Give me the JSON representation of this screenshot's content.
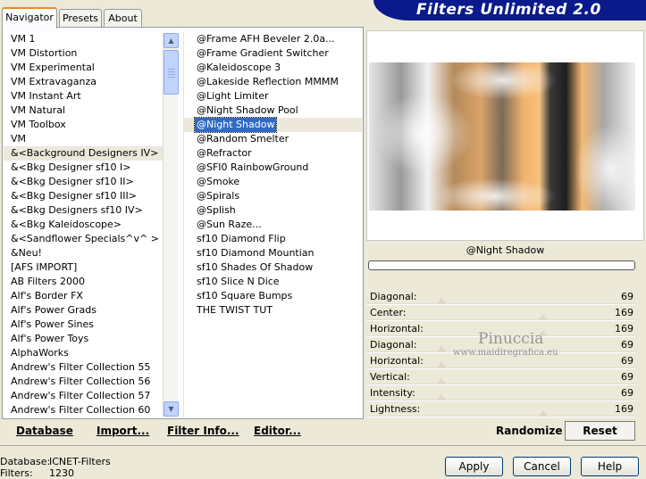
{
  "app_title": "Filters Unlimited 2.0",
  "tabs": [
    {
      "label": "Navigator",
      "active": true
    },
    {
      "label": "Presets",
      "active": false
    },
    {
      "label": "About",
      "active": false
    }
  ],
  "categories": [
    "VM 1",
    "VM Distortion",
    "VM Experimental",
    "VM Extravaganza",
    "VM Instant Art",
    "VM Natural",
    "VM Toolbox",
    "VM",
    "&<Background Designers IV>",
    "&<Bkg Designer sf10 I>",
    "&<Bkg Designer sf10 II>",
    "&<Bkg Designer sf10 III>",
    "&<Bkg Designers sf10 IV>",
    "&<Bkg Kaleidoscope>",
    "&<Sandflower Specials^v^ >",
    "&Neu!",
    "[AFS IMPORT]",
    "AB Filters 2000",
    "Alf's Border FX",
    "Alf's Power Grads",
    "Alf's Power Sines",
    "Alf's Power Toys",
    "AlphaWorks",
    "Andrew's Filter Collection 55",
    "Andrew's Filter Collection 56",
    "Andrew's Filter Collection 57",
    "Andrew's Filter Collection 60"
  ],
  "selected_category": "&<Background Designers IV>",
  "filters": [
    "@Frame AFH Beveler 2.0a...",
    "@Frame Gradient Switcher",
    "@Kaleidoscope 3",
    "@Lakeside Reflection MMMM",
    "@Light Limiter",
    "@Night Shadow Pool",
    "@Night Shadow",
    "@Random Smelter",
    "@Refractor",
    "@SFI0 RainbowGround",
    "@Smoke",
    "@Spirals",
    "@Splish",
    "@Sun Raze...",
    "sf10 Diamond Flip",
    "sf10 Diamond Mountian",
    "sf10 Shades Of Shadow",
    "sf10 Slice N Dice",
    "sf10 Square Bumps",
    "THE TWIST TUT"
  ],
  "selected_filter": "@Night Shadow",
  "preview": {
    "filter_name": "@Night Shadow"
  },
  "parameters": [
    {
      "label": "Diagonal:",
      "value": "69",
      "level": 69
    },
    {
      "label": "Center:",
      "value": "169",
      "level": 169
    },
    {
      "label": "Horizontal:",
      "value": "169",
      "level": 169
    },
    {
      "label": "Diagonal:",
      "value": "69",
      "level": 69
    },
    {
      "label": "Horizontal:",
      "value": "69",
      "level": 69
    },
    {
      "label": "Vertical:",
      "value": "69",
      "level": 69
    },
    {
      "label": "Intensity:",
      "value": "69",
      "level": 69
    },
    {
      "label": "Lightness:",
      "value": "169",
      "level": 169
    }
  ],
  "parameter_max": 255,
  "watermark": {
    "line1": "Pinuccia",
    "line2": "www.maidiregrafica.eu"
  },
  "left_buttons": {
    "database": "Database",
    "import": "Import...",
    "filter_info": "Filter Info...",
    "editor": "Editor..."
  },
  "right_buttons": {
    "randomize": "Randomize",
    "reset": "Reset"
  },
  "status": {
    "database_label": "Database:",
    "database_value": "ICNET-Filters",
    "filters_label": "Filters:",
    "filters_value": "1230"
  },
  "dialog_buttons": {
    "apply": "Apply",
    "cancel": "Cancel",
    "help": "Help"
  }
}
